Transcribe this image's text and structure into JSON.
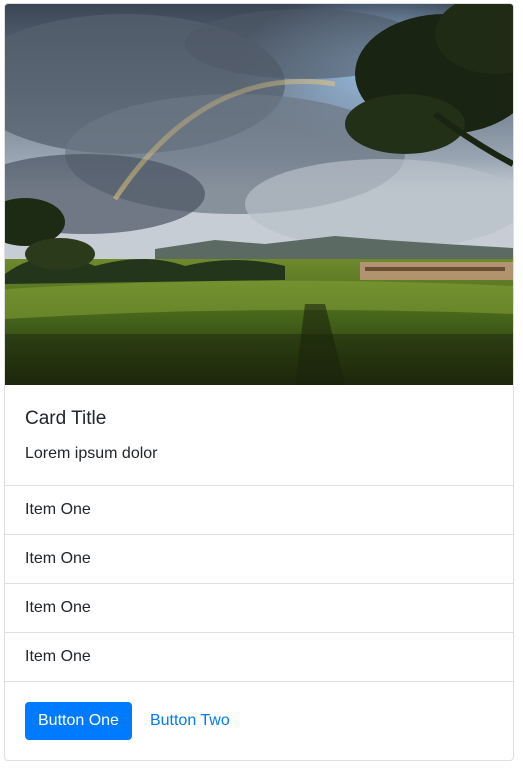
{
  "card": {
    "image": {
      "alt_semantic": "landscape-photo"
    },
    "title": "Card Title",
    "text": "Lorem ipsum dolor",
    "list_items": [
      {
        "label": "Item One"
      },
      {
        "label": "Item One"
      },
      {
        "label": "Item One"
      },
      {
        "label": "Item One"
      }
    ],
    "buttons": {
      "primary_label": "Button One",
      "link_label": "Button Two"
    }
  },
  "colors": {
    "primary": "#007bff",
    "text": "#212529",
    "border": "rgba(0,0,0,0.125)"
  }
}
